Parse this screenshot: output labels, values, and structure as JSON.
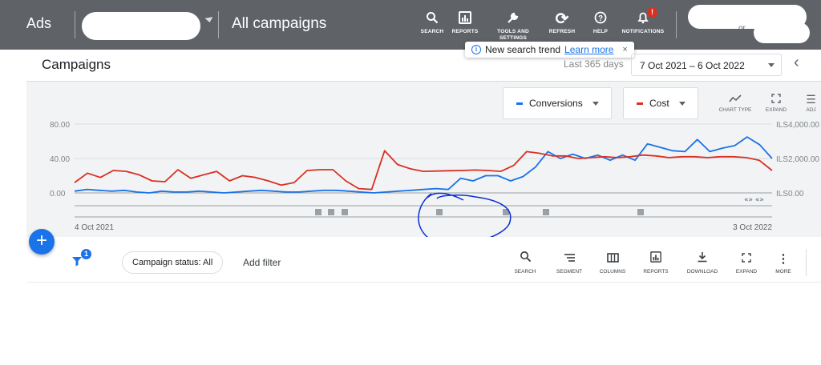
{
  "header": {
    "app_name": "Ads",
    "view_title": "All campaigns",
    "tools": [
      {
        "label": "SEARCH",
        "icon": "search-icon",
        "glyph": "🔍"
      },
      {
        "label": "REPORTS",
        "icon": "reports-icon",
        "glyph": "▦"
      },
      {
        "label": "TOOLS AND SETTINGS",
        "icon": "wrench-icon",
        "glyph": "🔧"
      },
      {
        "label": "REFRESH",
        "icon": "refresh-icon",
        "glyph": "⟳"
      },
      {
        "label": "HELP",
        "icon": "help-icon",
        "glyph": "?"
      },
      {
        "label": "NOTIFICATIONS",
        "icon": "bell-icon",
        "glyph": "🔔"
      }
    ],
    "notification_count": "!",
    "user_fragment": "or"
  },
  "tooltip": {
    "text": "New search trend",
    "link": "Learn more",
    "close": "×"
  },
  "page": {
    "title": "Campaigns",
    "range_label": "Last 365 days",
    "date_range": "7 Oct 2021 – 6 Oct 2022",
    "back": "‹"
  },
  "chart_controls": {
    "metric1": "Conversions",
    "metric2": "Cost",
    "chart_type_label": "CHART TYPE",
    "expand_label": "EXPAND",
    "adjust_label": "ADJ"
  },
  "chart_data": {
    "type": "line",
    "y_left_ticks": [
      "80.00",
      "40.00",
      "0.00"
    ],
    "y_right_ticks": [
      "ILS4,000.00",
      "ILS2,000.00",
      "ILS0.00"
    ],
    "y_left_range": [
      0,
      80
    ],
    "y_right_range": [
      0,
      4000
    ],
    "x_start_label": "4 Oct 2021",
    "x_end_label": "3 Oct 2022",
    "grid": true,
    "series": [
      {
        "name": "Conversions",
        "color": "#1a73e8",
        "axis": "left",
        "values": [
          2,
          4,
          3,
          2,
          3,
          1,
          0,
          2,
          1,
          1,
          2,
          1,
          0,
          1,
          2,
          3,
          2,
          1,
          1,
          2,
          3,
          3,
          2,
          1,
          0,
          1,
          2,
          3,
          4,
          5,
          4,
          17,
          14,
          20,
          20,
          14,
          19,
          30,
          48,
          40,
          45,
          40,
          44,
          38,
          44,
          38,
          57,
          53,
          49,
          48,
          62,
          48,
          52,
          55,
          65,
          56,
          40
        ]
      },
      {
        "name": "Cost",
        "color": "#d93025",
        "axis": "right",
        "values": [
          600,
          1150,
          900,
          1300,
          1250,
          1050,
          700,
          650,
          1350,
          850,
          1050,
          1250,
          700,
          1000,
          900,
          700,
          450,
          600,
          1300,
          1350,
          1350,
          700,
          250,
          200,
          2450,
          1650,
          1400,
          1250,
          1270,
          1290,
          1300,
          1330,
          1300,
          1250,
          1600,
          2400,
          2300,
          2150,
          2150,
          2000,
          2050,
          2100,
          2050,
          2100,
          2200,
          2150,
          2050,
          2100,
          2100,
          2050,
          2100,
          2100,
          2050,
          1900,
          1300
        ]
      }
    ]
  },
  "annotations_count": 7,
  "filter": {
    "badge": "1",
    "chip": "Campaign status: All",
    "add_filter": "Add filter"
  },
  "table_tools": [
    {
      "label": "SEARCH",
      "icon": "search-icon",
      "glyph": "🔍"
    },
    {
      "label": "SEGMENT",
      "icon": "segment-icon",
      "glyph": "≡"
    },
    {
      "label": "COLUMNS",
      "icon": "columns-icon",
      "glyph": "▥"
    },
    {
      "label": "REPORTS",
      "icon": "reports-icon",
      "glyph": "▦"
    },
    {
      "label": "DOWNLOAD",
      "icon": "download-icon",
      "glyph": "⤓"
    },
    {
      "label": "EXPAND",
      "icon": "expand-icon",
      "glyph": "⛶"
    },
    {
      "label": "MORE",
      "icon": "more-icon",
      "glyph": "⋮"
    }
  ],
  "fab_label": "+"
}
